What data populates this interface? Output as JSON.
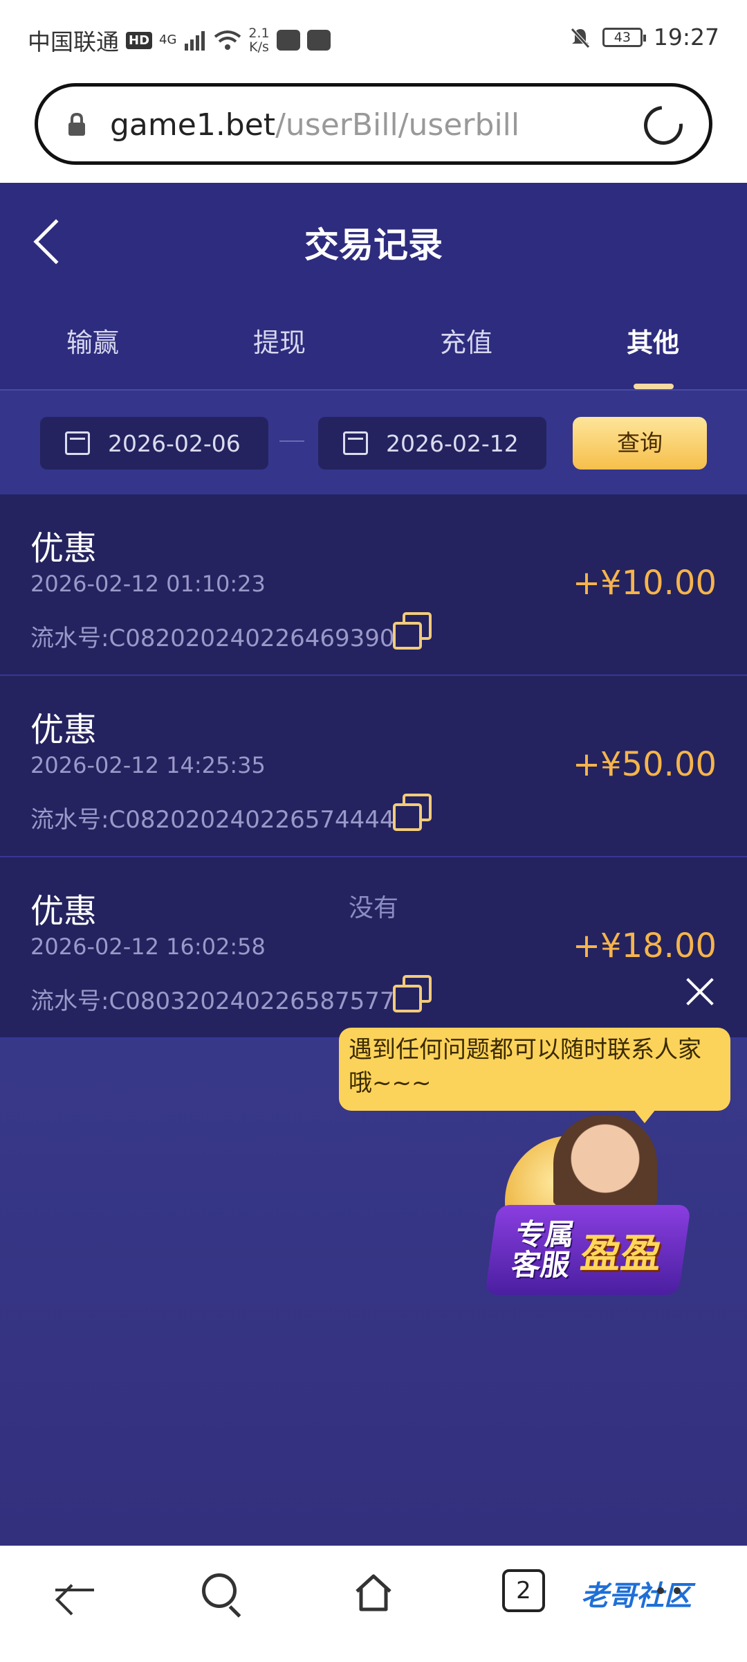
{
  "status_bar": {
    "carrier": "中国联通",
    "hd": "HD",
    "network": "4G",
    "speed_value": "2.1",
    "speed_unit": "K/s",
    "battery": "43",
    "time": "19:27"
  },
  "browser": {
    "url_host": "game1.bet",
    "url_path": "/userBill/userbill"
  },
  "header": {
    "title": "交易记录",
    "tabs": [
      {
        "label": "输赢"
      },
      {
        "label": "提现"
      },
      {
        "label": "充值"
      },
      {
        "label": "其他",
        "active": true
      }
    ]
  },
  "filter": {
    "start_date": "2026-02-06",
    "end_date": "2026-02-12",
    "query_label": "查询"
  },
  "records": [
    {
      "type": "优惠",
      "time": "2026-02-12 01:10:23",
      "serial": "流水号:C082020240226469390",
      "amount": "+¥10.00"
    },
    {
      "type": "优惠",
      "time": "2026-02-12 14:25:35",
      "serial": "流水号:C082020240226574444",
      "amount": "+¥50.00"
    },
    {
      "type": "优惠",
      "time": "2026-02-12 16:02:58",
      "serial": "流水号:C080320240226587577",
      "amount": "+¥18.00"
    }
  ],
  "no_more_text": "没有",
  "support": {
    "bubble_text": "遇到任何问题都可以随时联系人家哦~~~",
    "badge_small": "专属客服",
    "badge_big": "盈盈"
  },
  "navbar": {
    "tab_count": "2",
    "logo_text": "老哥社区"
  },
  "colors": {
    "header_bg": "#2e2c7e",
    "record_bg": "#24235f",
    "amount": "#f6b44b",
    "query_button": "#f6bf4a",
    "tab_indicator": "#f5dba2"
  }
}
